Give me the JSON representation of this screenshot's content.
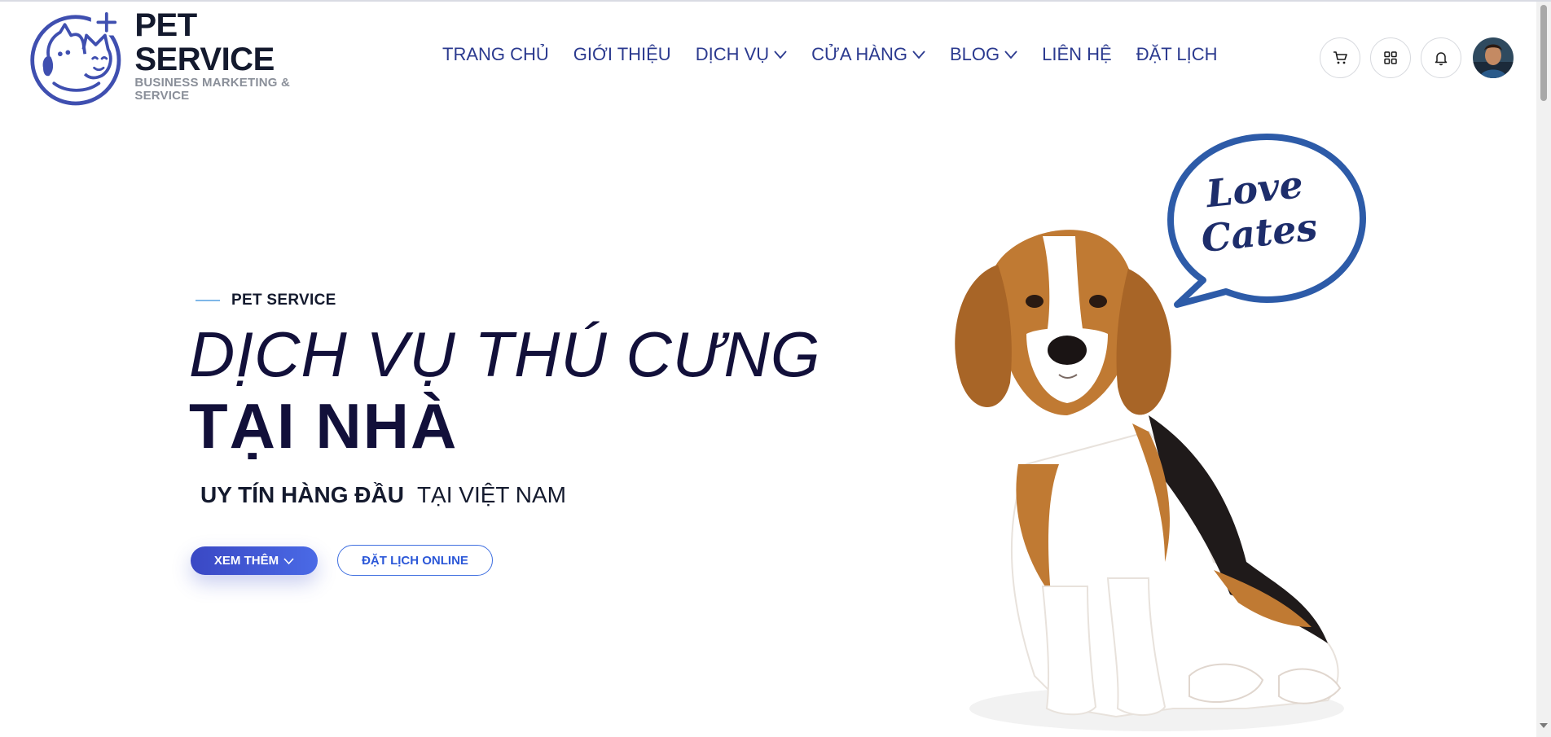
{
  "logo": {
    "title": "PET SERVICE",
    "subtitle": "BUSINESS MARKETING & SERVICE",
    "icon": "cat-dog-logo-icon"
  },
  "nav": {
    "items": [
      {
        "label": "TRANG CHỦ",
        "dropdown": false
      },
      {
        "label": "GIỚI THIỆU",
        "dropdown": false
      },
      {
        "label": "DỊCH VỤ",
        "dropdown": true
      },
      {
        "label": "CỬA HÀNG",
        "dropdown": true
      },
      {
        "label": "BLOG",
        "dropdown": true
      },
      {
        "label": "LIÊN HỆ",
        "dropdown": false
      },
      {
        "label": "ĐẶT LỊCH",
        "dropdown": false
      }
    ]
  },
  "actions": {
    "icons": [
      "cart-icon",
      "grid-icon",
      "bell-icon",
      "avatar"
    ]
  },
  "hero": {
    "eyebrow": "PET SERVICE",
    "headline_line1": "DỊCH VỤ THÚ CƯNG",
    "headline_line2": "TẠI NHÀ",
    "tagline_strong": "UY TÍN HÀNG ĐẦU",
    "tagline_light": "TẠI VIỆT NAM",
    "primary_button": "XEM THÊM",
    "secondary_button": "ĐẶT LỊCH ONLINE",
    "speech_bubble_line1": "Love",
    "speech_bubble_line2": "Cates"
  },
  "colors": {
    "nav_text": "#2b3a8f",
    "headline": "#12103a",
    "primary_button_start": "#3a48c4",
    "primary_button_end": "#4a6ae6",
    "outline_button": "#3f6fe0",
    "bubble_stroke": "#2d5ba8"
  }
}
